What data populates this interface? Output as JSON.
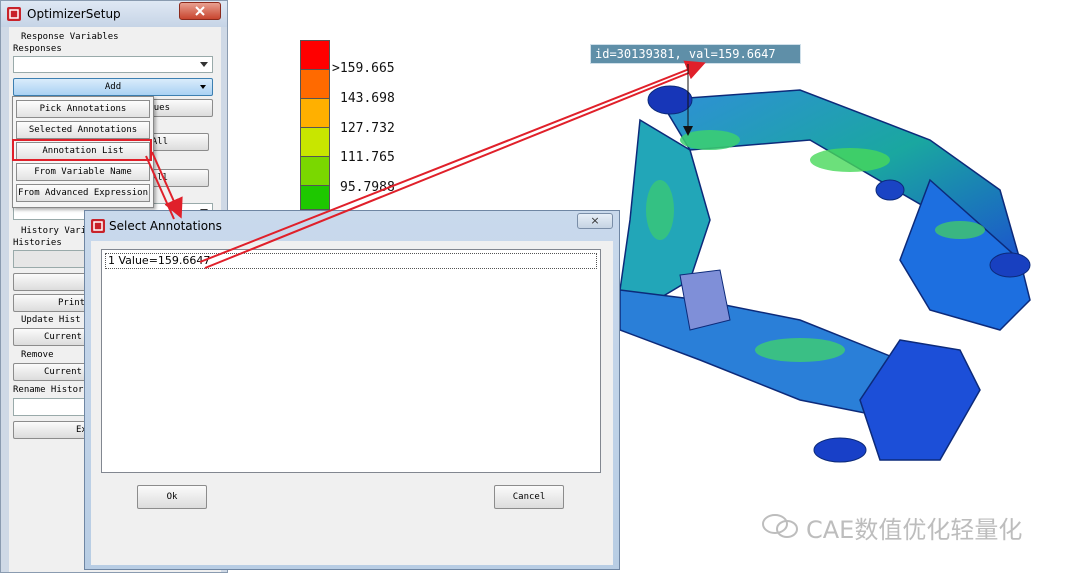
{
  "optimizer_setup": {
    "title": "OptimizerSetup",
    "close_label": "",
    "response_variables_label": "Response Variables",
    "responses_label": "Responses",
    "add_label": "Add",
    "add_menu": [
      "Pick Annotations",
      "Selected Annotations",
      "Annotation List",
      "From Variable Name",
      "From Advanced Expression"
    ],
    "partial_buttons": [
      "ues",
      "All",
      "All"
    ],
    "history_variables_label": "History Vari",
    "histories_label": "Histories",
    "print_label": "Print",
    "update_history_label": "Update Hist",
    "current_label_1": "Current",
    "remove_label": "Remove",
    "current_label_2": "Current",
    "rename_history_label": "Rename Histor",
    "exit_label": "Ex"
  },
  "legend": {
    "colors": [
      "#ff0000",
      "#ff6a00",
      "#ffb000",
      "#c8e600",
      "#7ad800",
      "#1ec800"
    ],
    "labels": [
      ">159.665",
      "143.698",
      "127.732",
      "111.765",
      "95.7988"
    ]
  },
  "callout": {
    "text": "id=30139381, val=159.6647"
  },
  "select_dialog": {
    "title": "Select Annotations",
    "close_label": "×",
    "item": "1 Value=159.6647",
    "ok_label": "Ok",
    "cancel_label": "Cancel"
  },
  "watermark": {
    "text": "CAE数值优化轻量化"
  }
}
